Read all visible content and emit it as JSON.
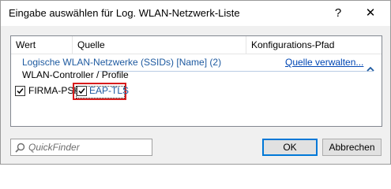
{
  "window": {
    "title": "Eingabe auswählen für Log. WLAN-Netzwerk-Liste",
    "help_label": "?",
    "close_label": "✕"
  },
  "table": {
    "columns": [
      "Wert",
      "Quelle",
      "Konfigurations-Pfad"
    ]
  },
  "group": {
    "title": "Logische WLAN-Netzwerke (SSIDs) [Name] (2)",
    "manage_link": "Quelle verwalten...",
    "subtitle": "WLAN-Controller / Profile",
    "items": [
      {
        "label": "FIRMA-PSK",
        "checked": true
      },
      {
        "label": "EAP-TLS",
        "checked": true
      }
    ]
  },
  "search": {
    "placeholder": "QuickFinder"
  },
  "buttons": {
    "ok": "OK",
    "cancel": "Abbrechen"
  },
  "colors": {
    "link": "#0046b4",
    "group_title": "#1e5aa0",
    "highlight_border": "#d81c1c"
  }
}
